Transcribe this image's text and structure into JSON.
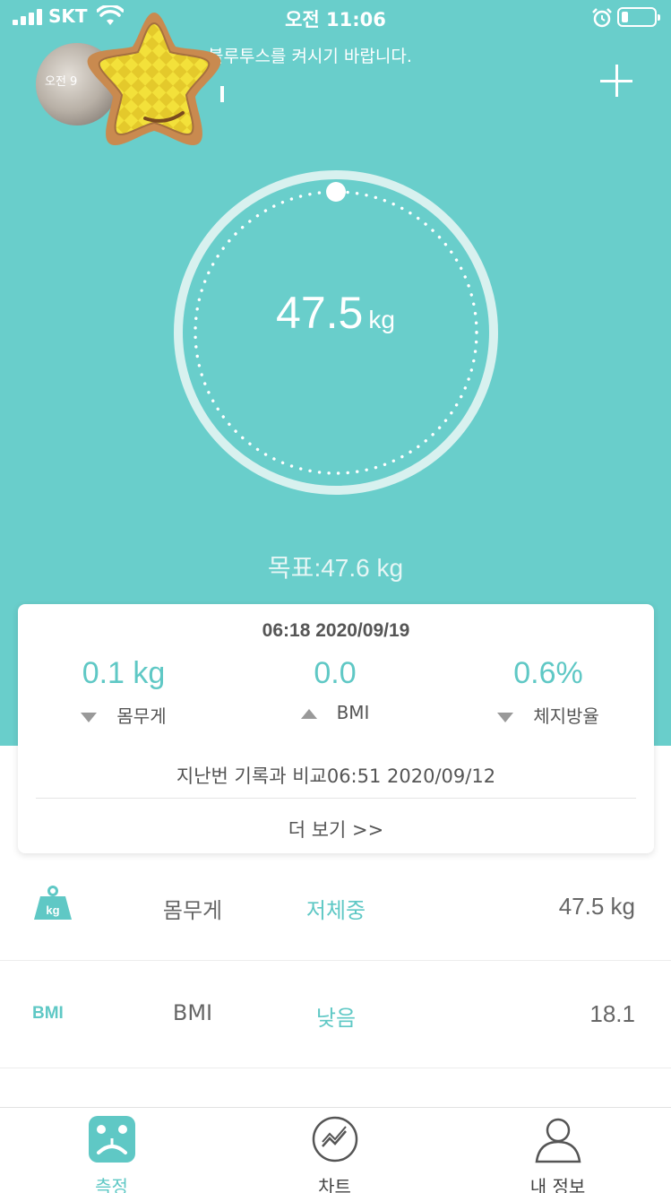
{
  "status_bar": {
    "carrier": "SKT",
    "time": "오전 11:06"
  },
  "header": {
    "bluetooth_message": "블루투스를 켜시기 바랍니다.",
    "avatar_caption": "오전 9",
    "avatar_icon": "profile-photo",
    "sticker_icon": "star-sticker",
    "add_icon": "plus-icon"
  },
  "gauge": {
    "value": "47.5",
    "unit": "kg",
    "goal": "목표:47.6 kg"
  },
  "card": {
    "date": "06:18 2020/09/19",
    "stats": [
      {
        "value": "0.1 kg",
        "label": "몸무게",
        "trend": "down"
      },
      {
        "value": "0.0",
        "label": "BMI",
        "trend": "up"
      },
      {
        "value": "0.6%",
        "label": "체지방율",
        "trend": "down"
      }
    ],
    "compare": "지난번 기록과 비교06:51 2020/09/12",
    "more": "더 보기 >>"
  },
  "metrics": [
    {
      "icon": "kg-weight-icon",
      "icon_text": "kg",
      "name": "몸무게",
      "status": "저체중",
      "value": "47.5 kg"
    },
    {
      "icon": "bmi-icon",
      "icon_text": "BMI",
      "name": "BMI",
      "status": "낮음",
      "value": "18.1"
    }
  ],
  "tabs": [
    {
      "label": "측정",
      "icon": "scale-icon",
      "active": true
    },
    {
      "label": "차트",
      "icon": "chart-icon",
      "active": false
    },
    {
      "label": "내 정보",
      "icon": "person-icon",
      "active": false
    }
  ],
  "colors": {
    "primary": "#69cecb",
    "accent": "#5fc8c5",
    "text": "#666666"
  }
}
